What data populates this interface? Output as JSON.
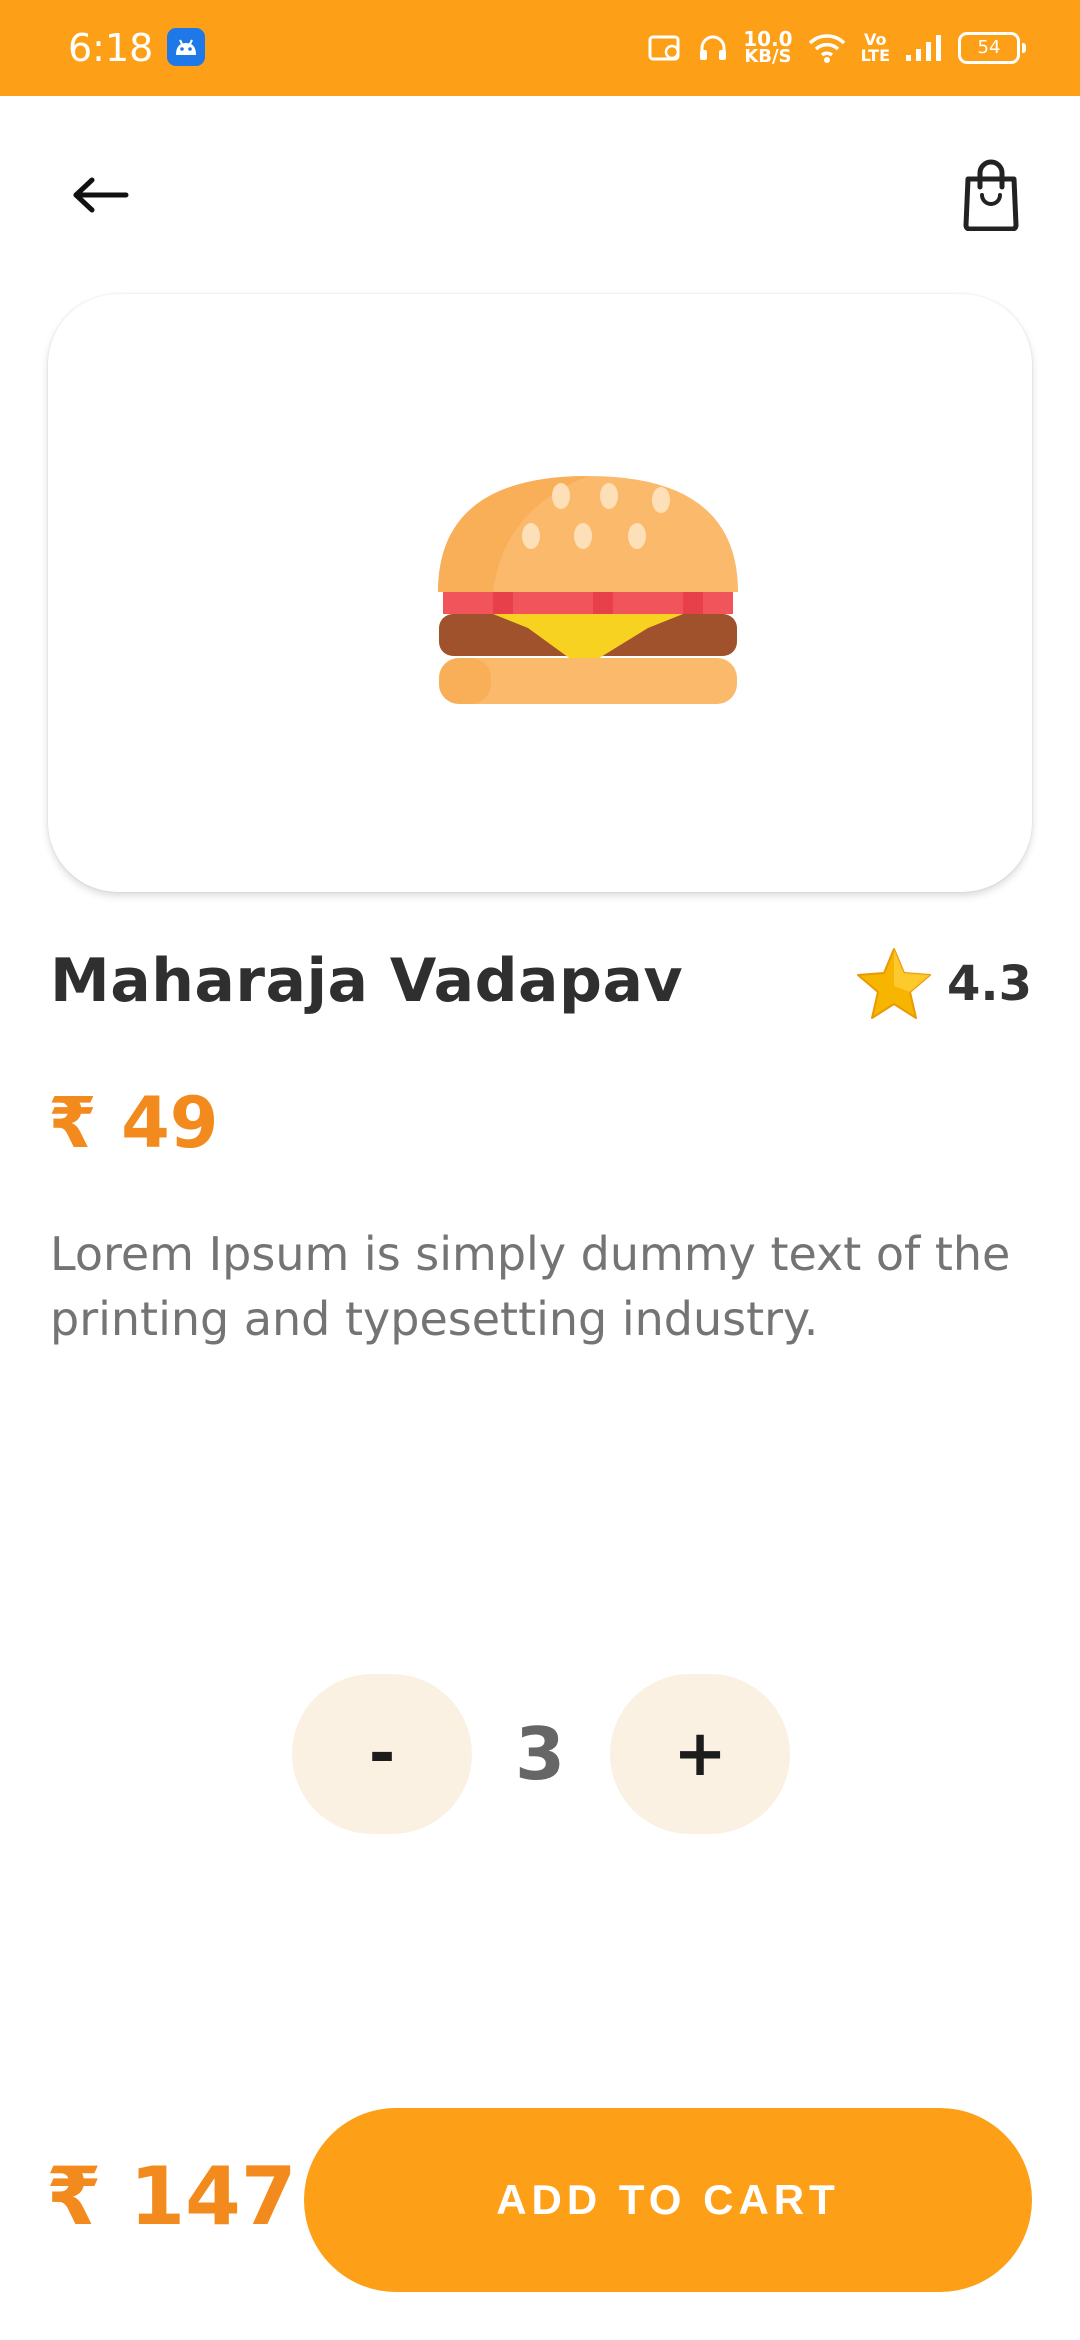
{
  "status_bar": {
    "time": "6:18",
    "speed_value": "10.0",
    "speed_unit": "KB/S",
    "volte_top": "Vo",
    "volte_bottom": "LTE",
    "battery": "54"
  },
  "colors": {
    "accent": "#FDA017",
    "price": "#F38A1E",
    "stepper_bg": "#FBF1E2",
    "star": "#F7B500"
  },
  "header": {
    "back_icon": "arrow-left-icon",
    "cart_icon": "shopping-bag-icon"
  },
  "product": {
    "image_icon": "burger-icon",
    "name": "Maharaja Vadapav",
    "rating": "4.3",
    "price": "₹ 49",
    "description": "Lorem Ipsum is simply dummy text of the printing and typesetting industry."
  },
  "quantity": {
    "minus_label": "-",
    "value": "3",
    "plus_label": "+"
  },
  "footer": {
    "total": "₹ 147",
    "add_to_cart_label": "ADD TO CART"
  }
}
